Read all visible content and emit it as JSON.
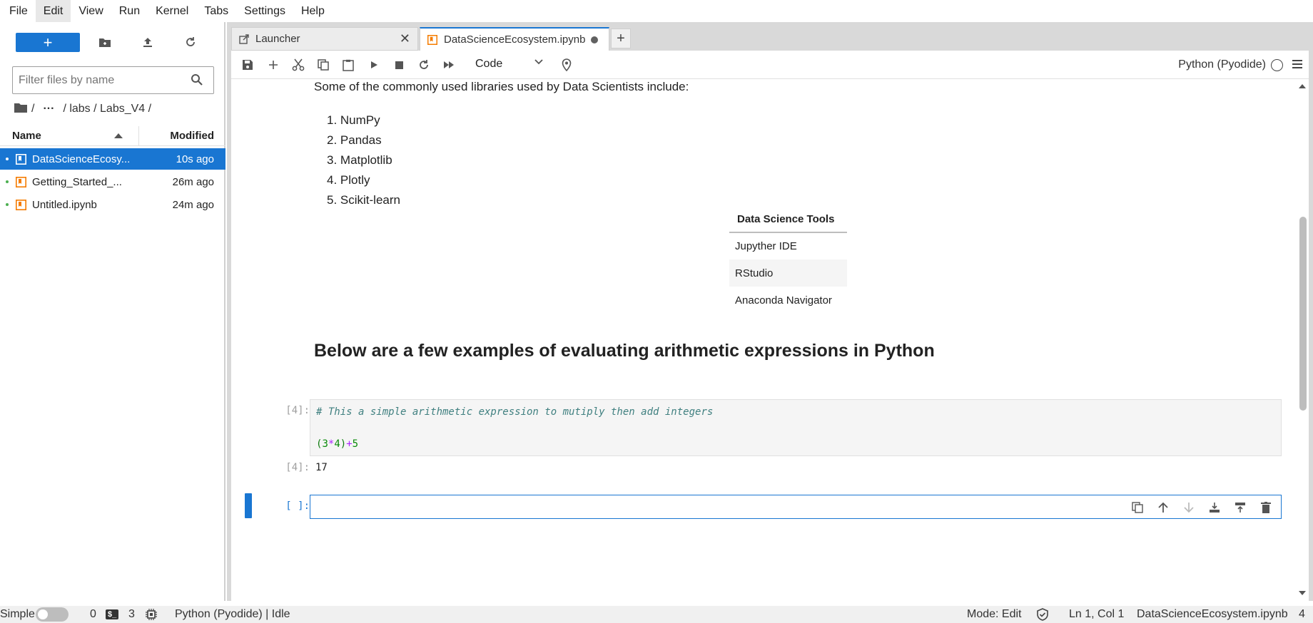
{
  "menu": [
    "File",
    "Edit",
    "View",
    "Run",
    "Kernel",
    "Tabs",
    "Settings",
    "Help"
  ],
  "sidebar": {
    "new_label": "+",
    "filter_placeholder": "Filter files by name",
    "breadcrumb": {
      "root": "/",
      "ellipsis": "···",
      "path": "/ labs / Labs_V4 /"
    },
    "columns": {
      "name": "Name",
      "modified": "Modified"
    },
    "files": [
      {
        "name": "DataScienceEcosy...",
        "modified": "10s ago"
      },
      {
        "name": "Getting_Started_...",
        "modified": "26m ago"
      },
      {
        "name": "Untitled.ipynb",
        "modified": "24m ago"
      }
    ]
  },
  "tabs": [
    {
      "label": "Launcher"
    },
    {
      "label": "DataScienceEcosystem.ipynb"
    }
  ],
  "toolbar": {
    "cell_type": "Code",
    "kernel": "Python (Pyodide)"
  },
  "notebook": {
    "intro": "Some of the commonly used libraries used by Data Scientists include:",
    "libraries": [
      "NumPy",
      "Pandas",
      "Matplotlib",
      "Plotly",
      "Scikit-learn"
    ],
    "table": {
      "header": "Data Science Tools",
      "rows": [
        "Jupyther IDE",
        "RStudio",
        "Anaconda Navigator"
      ]
    },
    "heading": "Below are a few examples of evaluating arithmetic expressions in Python",
    "code_prompt": "[4]:",
    "code_comment": "# This a simple arithmetic expression to mutiply then add integers",
    "code_expr": {
      "open": "(",
      "a": "3",
      "op1": "*",
      "b": "4",
      "close": ")",
      "op2": "+",
      "c": "5"
    },
    "output_prompt": "[4]:",
    "output_value": "17",
    "empty_prompt": "[ ]:"
  },
  "statusbar": {
    "mode_label": "Simple",
    "count_a": "0",
    "count_b": "3",
    "kernel_status": "Python (Pyodide) | Idle",
    "mode": "Mode: Edit",
    "cursor": "Ln 1, Col 1",
    "file": "DataScienceEcosystem.ipynb",
    "extra": "4"
  },
  "colors": {
    "accent": "#1976d2",
    "notebook_orange": "#f57c00"
  }
}
